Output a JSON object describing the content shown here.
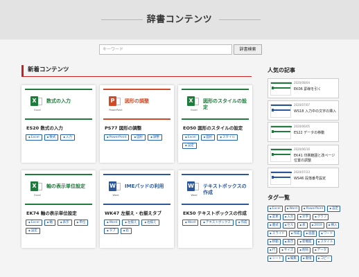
{
  "header": {
    "title": "辞書コンテンツ"
  },
  "search": {
    "placeholder": "キーワード",
    "button": "辞書検索"
  },
  "section_title": "新着コンテンツ",
  "cards": [
    {
      "thumb_text": "数式の入力",
      "app": "Excel",
      "icon_letter": "X",
      "title": "ES20 数式の入力",
      "tags": [
        "Excel",
        "数式",
        "入力"
      ]
    },
    {
      "thumb_text": "図形の調整",
      "app": "PowerPoint",
      "icon_letter": "P",
      "title": "PS77 図形の調整",
      "tags": [
        "PowerPoint",
        "図形",
        "調整"
      ]
    },
    {
      "thumb_text": "図形のスタイルの設定",
      "app": "Excel",
      "icon_letter": "X",
      "title": "EO50 図形のスタイルの設定",
      "tags": [
        "Excel",
        "図形",
        "スタイル",
        "設定"
      ]
    },
    {
      "thumb_text": "軸の表示単位設定",
      "app": "Excel",
      "icon_letter": "X",
      "title": "EK74 軸の表示単位設定",
      "tags": [
        "Excel",
        "軸",
        "表示",
        "単位",
        "設定"
      ]
    },
    {
      "thumb_text": "IMEパッドの利用",
      "app": "Word",
      "icon_letter": "W",
      "title": "WK47 左揃え・右揃えタブ",
      "tags": [
        "Word",
        "左揃え",
        "右揃え",
        "タブ",
        "右"
      ]
    },
    {
      "thumb_text": "テキストボックスの作成",
      "app": "Word",
      "icon_letter": "W",
      "title": "EK50 テキストボックスの作成",
      "tags": [
        "Word",
        "テキストボックス",
        "作成"
      ]
    }
  ],
  "sidebar": {
    "popular_title": "人気の記事",
    "popular": [
      {
        "date": "2020/08/04",
        "title": "EK06 罫線を引く"
      },
      {
        "date": "2020/07/07",
        "title": "WS18 入力中の文字の挿入"
      },
      {
        "date": "2020/06/05",
        "title": "ES22 データの移動"
      },
      {
        "date": "2020/06/16",
        "title": "EK41 印刷範囲と改ページ位置の調整"
      },
      {
        "date": "2020/07/23",
        "title": "WS46 段落番号設定"
      }
    ],
    "tags_title": "タグ一覧",
    "tags": [
      "Excel",
      "Word",
      "PowerPoint",
      "設定",
      "変更",
      "入力",
      "文字",
      "グラフ",
      "書式",
      "セル",
      "表",
      "2019",
      "挿入",
      "スライド",
      "作成",
      "画面",
      "ワード",
      "移動",
      "表示",
      "新機能",
      "スタイル",
      "行",
      "サイズ",
      "削除",
      "データ",
      "シート",
      "編集",
      "書換",
      "コピー"
    ]
  },
  "colors": {
    "excel": "#1e7b3c",
    "word": "#2b579a",
    "powerpoint": "#d04a25",
    "tag": "#1e5fa6",
    "accent": "#c81f1f"
  }
}
